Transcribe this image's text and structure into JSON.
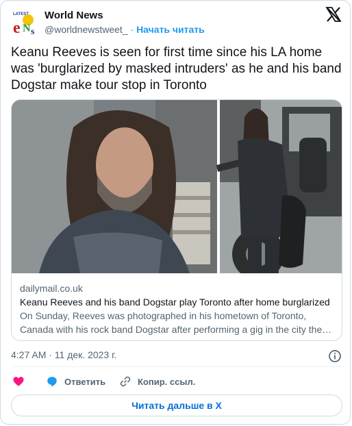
{
  "header": {
    "account_name": "World News",
    "handle": "@worldnewstweet_",
    "separator": "·",
    "follow_label": "Начать читать"
  },
  "tweet": {
    "text": "Keanu Reeves is seen for first time since his LA home was 'burglarized by masked intruders' as he and his band Dogstar make tour stop in Toronto"
  },
  "link_card": {
    "domain": "dailymail.co.uk",
    "title": "Keanu Reeves and his band Dogstar play Toronto after home burglarized",
    "description": "On Sunday, Reeves was photographed in his hometown of Toronto, Canada with his rock band Dogstar after performing a gig in the city the…"
  },
  "meta": {
    "timestamp": "4:27 AM · 11 дек. 2023 г."
  },
  "actions": {
    "reply_label": "Ответить",
    "copy_label": "Копир. ссыл."
  },
  "read_more": {
    "label": "Читать дальше в X"
  },
  "colors": {
    "like": "#f91880",
    "reply": "#1d9bf0",
    "link": "#1d9bf0",
    "read_more_text": "#006fd6",
    "border": "#cfd9de"
  }
}
